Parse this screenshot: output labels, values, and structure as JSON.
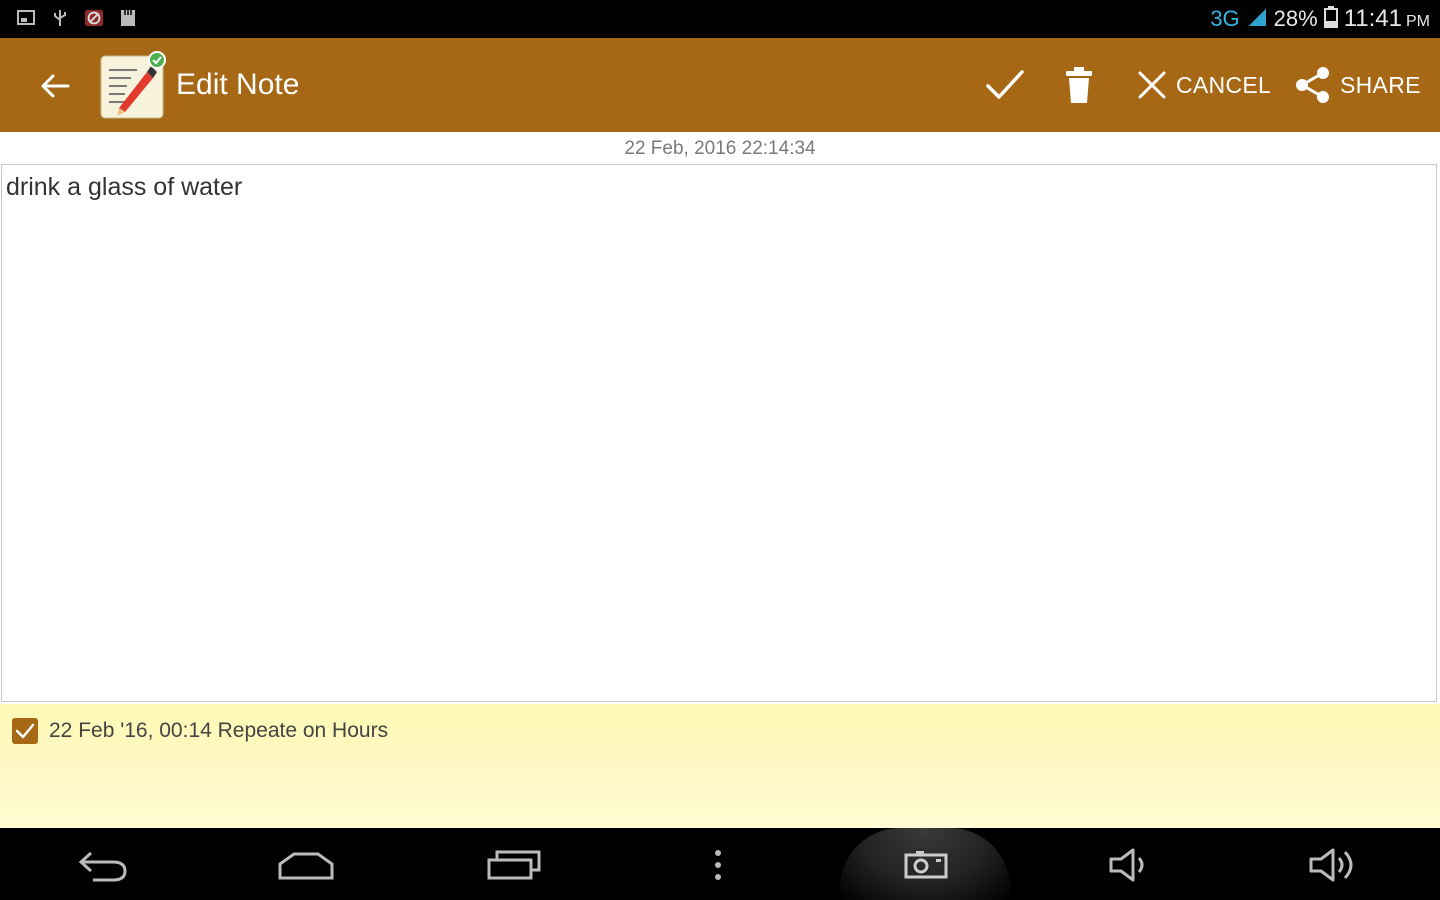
{
  "status_bar": {
    "network": "3G",
    "battery": "28%",
    "time": "11:41",
    "ampm": "PM"
  },
  "action_bar": {
    "title": "Edit Note",
    "cancel_label": "CANCEL",
    "share_label": "SHARE",
    "accent_color": "#a66815"
  },
  "note": {
    "timestamp": "22 Feb, 2016 22:14:34",
    "text": "drink a glass of water"
  },
  "reminder": {
    "checked": true,
    "text": "22 Feb '16, 00:14 Repeate on Hours"
  },
  "nav_bar": {
    "buttons": [
      "back-icon",
      "home-icon",
      "recent-apps-icon",
      "menu-icon",
      "screenshot-icon",
      "volume-down-icon",
      "volume-up-icon"
    ]
  }
}
